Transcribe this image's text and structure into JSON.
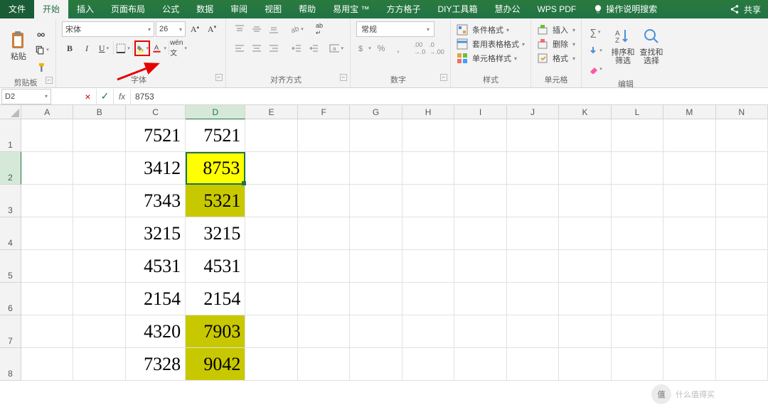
{
  "tabs": {
    "file": "文件",
    "home": "开始",
    "insert": "插入",
    "layout": "页面布局",
    "formula": "公式",
    "data": "数据",
    "review": "审阅",
    "view": "视图",
    "help": "帮助",
    "yyb": "易用宝 ™",
    "fgz": "方方格子",
    "diy": "DIY工具箱",
    "hbg": "慧办公",
    "wps": "WPS PDF",
    "tellme": "操作说明搜索",
    "share": "共享"
  },
  "ribbon": {
    "clipboard_label": "剪贴板",
    "paste": "粘贴",
    "font_label": "字体",
    "font_name": "宋体",
    "font_size": "26",
    "align_label": "对齐方式",
    "number_label": "数字",
    "number_format": "常规",
    "styles_label": "样式",
    "cond_format": "条件格式",
    "table_format": "套用表格格式",
    "cell_style": "单元格样式",
    "cells_label": "单元格",
    "insert": "插入",
    "delete": "删除",
    "format": "格式",
    "editing_label": "编辑",
    "sort_filter": "排序和筛选",
    "find_select": "查找和选择"
  },
  "formula_bar": {
    "name_box": "D2",
    "formula": "8753"
  },
  "columns": [
    "A",
    "B",
    "C",
    "D",
    "E",
    "F",
    "G",
    "H",
    "I",
    "J",
    "K",
    "L",
    "M",
    "N"
  ],
  "rows": [
    1,
    2,
    3,
    4,
    5,
    6,
    7,
    8
  ],
  "selected_cell": "D2",
  "cell_data": {
    "C1": "7521",
    "D1": "7521",
    "C2": "3412",
    "D2": "8753",
    "C3": "7343",
    "D3": "5321",
    "C4": "3215",
    "D4": "3215",
    "C5": "4531",
    "D5": "4531",
    "C6": "2154",
    "D6": "2154",
    "C7": "4320",
    "D7": "7903",
    "C8": "7328",
    "D8": "9042"
  },
  "highlights": {
    "D2": "hl1",
    "D3": "hl2",
    "D7": "hl2",
    "D8": "hl2"
  },
  "watermark": "什么值得买"
}
